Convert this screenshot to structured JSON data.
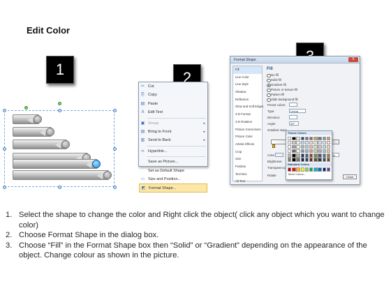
{
  "title": "Edit Color",
  "step_badges": [
    "1",
    "2",
    "3"
  ],
  "context_menu": {
    "items": [
      {
        "label": "Cut",
        "icon": "scissors-icon",
        "glyph": "✂"
      },
      {
        "label": "Copy",
        "icon": "copy-icon",
        "glyph": "⎘"
      },
      {
        "label": "Paste",
        "icon": "paste-icon",
        "glyph": "📋"
      },
      {
        "label": "Edit Text",
        "icon": "edit-text-icon",
        "glyph": "A"
      },
      {
        "label": "Group",
        "icon": "group-icon",
        "glyph": "▣",
        "submenu": true
      },
      {
        "label": "Bring to Front",
        "icon": "bring-front-icon",
        "glyph": "▤",
        "submenu": true
      },
      {
        "label": "Send to Back",
        "icon": "send-back-icon",
        "glyph": "▥",
        "submenu": true
      },
      {
        "label": "Hyperlink...",
        "icon": "hyperlink-icon",
        "glyph": "🔗"
      },
      {
        "label": "Save as Picture...",
        "icon": "",
        "glyph": ""
      },
      {
        "label": "Set as Default Shape",
        "icon": "",
        "glyph": ""
      },
      {
        "label": "Size and Position...",
        "icon": "size-icon",
        "glyph": "▭"
      },
      {
        "label": "Format Shape...",
        "icon": "format-shape-icon",
        "glyph": "◩"
      }
    ]
  },
  "dialog": {
    "title": "Format Shape",
    "close_label": "X",
    "sidebar": [
      "Fill",
      "Line Color",
      "Line Style",
      "Shadow",
      "Reflection",
      "Glow and Soft Edges",
      "3-D Format",
      "3-D Rotation",
      "Picture Corrections",
      "Picture Color",
      "Artistic Effects",
      "Crop",
      "Size",
      "Position",
      "Text Box",
      "Alt Text"
    ],
    "section": "Fill",
    "fill_options": [
      "No fill",
      "Solid fill",
      "Gradient fill",
      "Picture or texture fill",
      "Pattern fill",
      "Slide background fill"
    ],
    "selected_fill": "Gradient fill",
    "rows": [
      "Preset colors:",
      "Type:",
      "Direction:",
      "Angle:"
    ],
    "type_value": "Linear",
    "angle_value": "90°",
    "gradient_stops_label": "Gradient stops",
    "color_label": "Color",
    "position_label": "Position:",
    "position_value": "0%",
    "brightness_label": "Brightness:",
    "transparency_label": "Transparency:",
    "rotate_label": "Rotate",
    "close_button": "Close"
  },
  "palette": {
    "theme_header": "Theme Colors",
    "standard_header": "Standard Colors",
    "more": "More Colors...",
    "theme_colors": [
      "#ffffff",
      "#000000",
      "#eeece1",
      "#1f497d",
      "#4f81bd",
      "#c0504d",
      "#9bbb59",
      "#8064a2",
      "#4bacc6",
      "#f79646"
    ],
    "standard_colors": [
      "#c00000",
      "#ff0000",
      "#ffc000",
      "#ffff00",
      "#92d050",
      "#00b050",
      "#00b0f0",
      "#0070c0",
      "#002060",
      "#7030a0"
    ]
  },
  "instructions": [
    {
      "num": "1.",
      "text": "Select the shape to change the color and Right click the object( click any object which you want to change color)"
    },
    {
      "num": "2.",
      "text": "Choose Format Shape in the dialog box."
    },
    {
      "num": "3.",
      "text": "Choose “Fill” in the Format Shape box then “Solid” or “Gradient” depending on the appearance of the object. Change colour as shown in the picture."
    }
  ],
  "colors": {
    "accent_cap": "#1e8fe0",
    "highlight": "#fce7a8",
    "badge_bg": "#000000"
  }
}
